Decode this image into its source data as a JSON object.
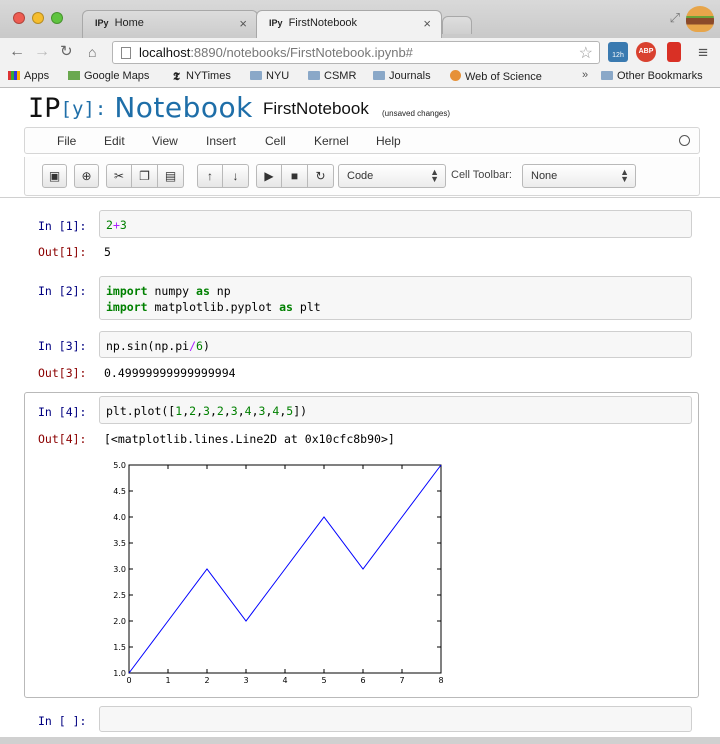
{
  "browser": {
    "tabs": [
      {
        "favicon": "IPy",
        "label": "Home",
        "active": false
      },
      {
        "favicon": "IPy",
        "label": "FirstNotebook",
        "active": true
      }
    ],
    "url_host": "localhost",
    "url_rest": ":8890/notebooks/FirstNotebook.ipynb#",
    "extensions": {
      "calendar_badge": "12h",
      "abp_badge": "ABP"
    },
    "bookmarks": [
      {
        "label": "Apps",
        "icon": "apps-grid-icon"
      },
      {
        "label": "Google Maps",
        "icon": "maps-icon"
      },
      {
        "label": "NYTimes",
        "icon": "nyt-icon"
      },
      {
        "label": "NYU",
        "icon": "folder-icon"
      },
      {
        "label": "CSMR",
        "icon": "folder-icon"
      },
      {
        "label": "Journals",
        "icon": "folder-icon"
      },
      {
        "label": "Web of Science",
        "icon": "wos-icon"
      }
    ],
    "bookmarks_overflow": "»",
    "other_bookmarks": "Other Bookmarks"
  },
  "notebook": {
    "logo_ip": "IP",
    "logo_y": "[y]:",
    "logo_nb": "Notebook",
    "name": "FirstNotebook",
    "status": "(unsaved changes)",
    "menu": [
      "File",
      "Edit",
      "View",
      "Insert",
      "Cell",
      "Kernel",
      "Help"
    ],
    "toolbar": {
      "cell_type": "Code",
      "cell_toolbar_label": "Cell Toolbar:",
      "cell_toolbar_value": "None"
    },
    "cells": [
      {
        "in_prompt": "In [1]:",
        "code": "2+3",
        "out_prompt": "Out[1]:",
        "output": "5"
      },
      {
        "in_prompt": "In [2]:",
        "code": "import numpy as np\nimport matplotlib.pyplot as plt"
      },
      {
        "in_prompt": "In [3]:",
        "code": "np.sin(np.pi/6)",
        "out_prompt": "Out[3]:",
        "output": "0.49999999999999994"
      },
      {
        "in_prompt": "In [4]:",
        "code": "plt.plot([1,2,3,2,3,4,3,4,5])",
        "out_prompt": "Out[4]:",
        "output": "[<matplotlib.lines.Line2D at 0x10cfc8b90>]"
      },
      {
        "in_prompt": "In [ ]:",
        "code": ""
      }
    ]
  },
  "chart_data": {
    "type": "line",
    "x": [
      0,
      1,
      2,
      3,
      4,
      5,
      6,
      7,
      8
    ],
    "series": [
      {
        "values": [
          1,
          2,
          3,
          2,
          3,
          4,
          3,
          4,
          5
        ],
        "color": "#0000ff"
      }
    ],
    "xlim": [
      0,
      8
    ],
    "ylim": [
      1.0,
      5.0
    ],
    "xticks": [
      "0",
      "1",
      "2",
      "3",
      "4",
      "5",
      "6",
      "7",
      "8"
    ],
    "yticks": [
      "1.0",
      "1.5",
      "2.0",
      "2.5",
      "3.0",
      "3.5",
      "4.0",
      "4.5",
      "5.0"
    ],
    "grid": false,
    "title": "",
    "xlabel": "",
    "ylabel": ""
  }
}
